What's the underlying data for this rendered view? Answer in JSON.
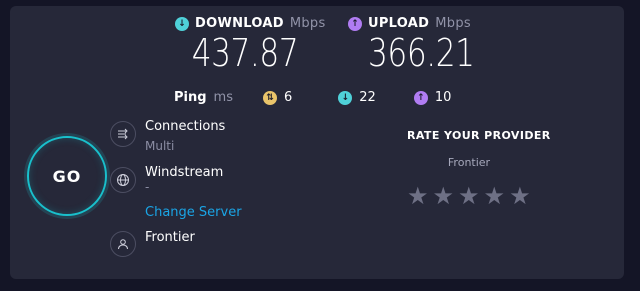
{
  "download": {
    "label": "DOWNLOAD",
    "unit": "Mbps",
    "value": "437.87",
    "icon": "download-arrow-icon",
    "color": "#4fd1d9"
  },
  "upload": {
    "label": "UPLOAD",
    "unit": "Mbps",
    "value": "366.21",
    "icon": "upload-arrow-icon",
    "color": "#b07cf2"
  },
  "ping": {
    "label": "Ping",
    "unit": "ms",
    "idle": {
      "value": "6",
      "icon": "idle-latency-icon",
      "color": "#e9c46a"
    },
    "download": {
      "value": "22",
      "icon": "download-latency-icon",
      "color": "#4fd1d9"
    },
    "upload": {
      "value": "10",
      "icon": "upload-latency-icon",
      "color": "#b07cf2"
    }
  },
  "go_button": {
    "label": "GO"
  },
  "connections": {
    "title": "Connections",
    "subtitle": "Multi",
    "icon": "connections-icon"
  },
  "server": {
    "title": "Windstream",
    "subtitle": "-",
    "change_label": "Change Server",
    "icon": "globe-icon"
  },
  "provider": {
    "title": "Frontier",
    "icon": "user-icon"
  },
  "rating": {
    "title": "RATE YOUR PROVIDER",
    "provider": "Frontier",
    "stars": 5,
    "selected": 0
  },
  "colors": {
    "accent": "#19c0cc",
    "link": "#1aa5e6",
    "panel": "#262839",
    "background": "#141526"
  }
}
